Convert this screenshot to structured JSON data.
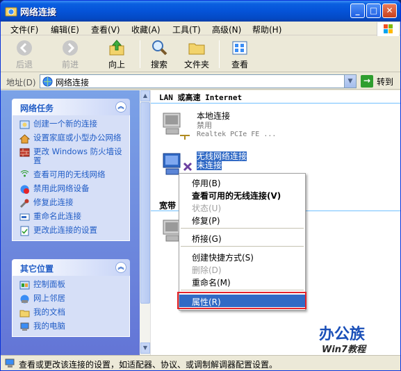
{
  "window": {
    "title": "网络连接"
  },
  "menubar": [
    "文件(F)",
    "编辑(E)",
    "查看(V)",
    "收藏(A)",
    "工具(T)",
    "高级(N)",
    "帮助(H)"
  ],
  "toolbar": {
    "back": "后退",
    "forward": "前进",
    "up": "向上",
    "search": "搜索",
    "folders": "文件夹",
    "view": "查看"
  },
  "address": {
    "label": "地址(D)",
    "value": "网络连接",
    "go": "转到"
  },
  "network_tasks": {
    "title": "网络任务",
    "items": [
      "创建一个新的连接",
      "设置家庭或小型办公网络",
      "更改 Windows 防火墙设置",
      "查看可用的无线网络",
      "禁用此网络设备",
      "修复此连接",
      "重命名此连接",
      "更改此连接的设置"
    ]
  },
  "other_places": {
    "title": "其它位置",
    "items": [
      "控制面板",
      "网上邻居",
      "我的文档",
      "我的电脑"
    ]
  },
  "groups": {
    "lan": "LAN 或高速 Internet",
    "broadband": "宽带"
  },
  "connections": {
    "local": {
      "name": "本地连接",
      "status": "禁用",
      "device": "Realtek PCIe FE ..."
    },
    "wireless": {
      "name": "无线网络连接",
      "status": "未连接"
    }
  },
  "context_menu": {
    "disable": "停用(B)",
    "view_wireless": "查看可用的无线连接(V)",
    "status": "状态(U)",
    "repair": "修复(P)",
    "bridge": "桥接(G)",
    "shortcut": "创建快捷方式(S)",
    "delete": "删除(D)",
    "rename": "重命名(M)",
    "properties": "属性(R)"
  },
  "status_bar": "查看或更改该连接的设置，如适配器、协议、或调制解调器配置设置。",
  "watermark": {
    "brand": "办公族",
    "sub": "Win7教程"
  }
}
